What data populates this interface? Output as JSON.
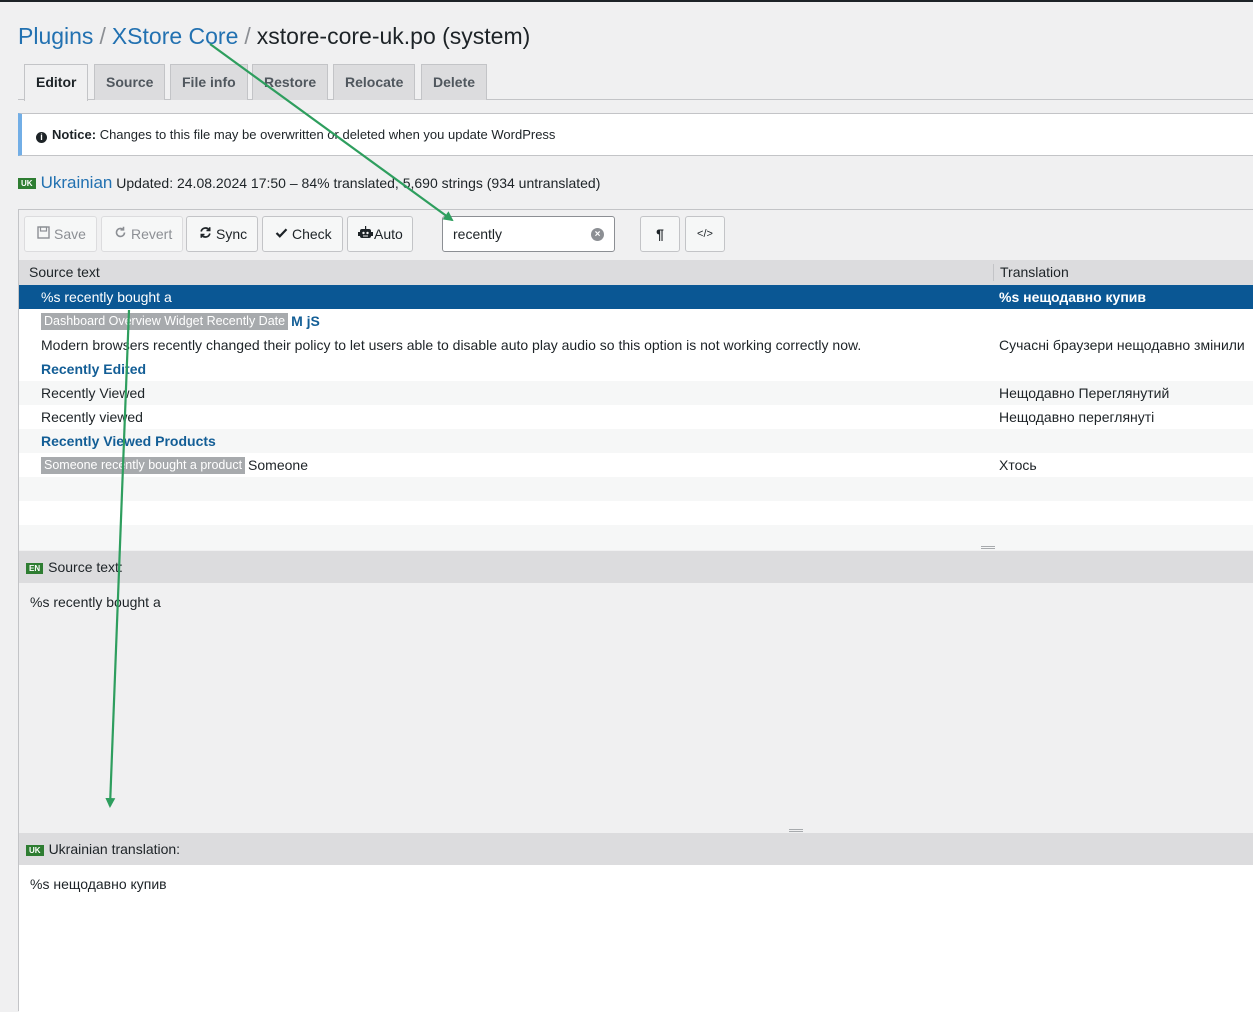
{
  "breadcrumb": {
    "plugins": "Plugins",
    "plugin": "XStore Core",
    "file": "xstore-core-uk.po (system)",
    "sep": "/"
  },
  "tabs": [
    "Editor",
    "Source",
    "File info",
    "Restore",
    "Relocate",
    "Delete"
  ],
  "notice": {
    "label": "Notice:",
    "text": "Changes to this file may be overwritten or deleted when you update WordPress"
  },
  "language": {
    "code": "UK",
    "name": "Ukrainian",
    "status": "Updated: 24.08.2024 17:50 – 84% translated, 5,690 strings (934 untranslated)"
  },
  "toolbar": {
    "save": "Save",
    "revert": "Revert",
    "sync": "Sync",
    "check": "Check",
    "auto": "Auto",
    "pilcrow": "¶",
    "code": "</>"
  },
  "search": {
    "value": "recently",
    "clear": "×"
  },
  "list": {
    "col_source": "Source text",
    "col_translation": "Translation",
    "rows": [
      {
        "source": "%s recently bought a",
        "translation": "%s нещодавно купив"
      },
      {
        "tag": "Dashboard Overview Widget Recently Date",
        "source": "M jS",
        "translation": ""
      },
      {
        "source": "Modern browsers recently changed their policy to let users able to disable auto play audio so this option is not working correctly now.",
        "translation": "Сучасні браузери нещодавно змінили"
      },
      {
        "source": "Recently Edited",
        "translation": ""
      },
      {
        "source": "Recently Viewed",
        "translation": "Нещодавно Переглянутий"
      },
      {
        "source": "Recently viewed",
        "translation": "Нещодавно переглянуті"
      },
      {
        "source": "Recently Viewed Products",
        "translation": ""
      },
      {
        "tag": "Someone recently bought a product",
        "source": "Someone",
        "translation": "Хтось"
      }
    ]
  },
  "source_pane": {
    "code": "EN",
    "label": "Source text:",
    "value": "%s recently bought a"
  },
  "translation_pane": {
    "code": "UK",
    "label": "Ukrainian translation:",
    "value": "%s нещодавно купив"
  },
  "colors": {
    "link": "#2271b1",
    "selected_row": "#0a5794",
    "arrow": "#2e9e5e",
    "flag": "#2e7d32"
  }
}
